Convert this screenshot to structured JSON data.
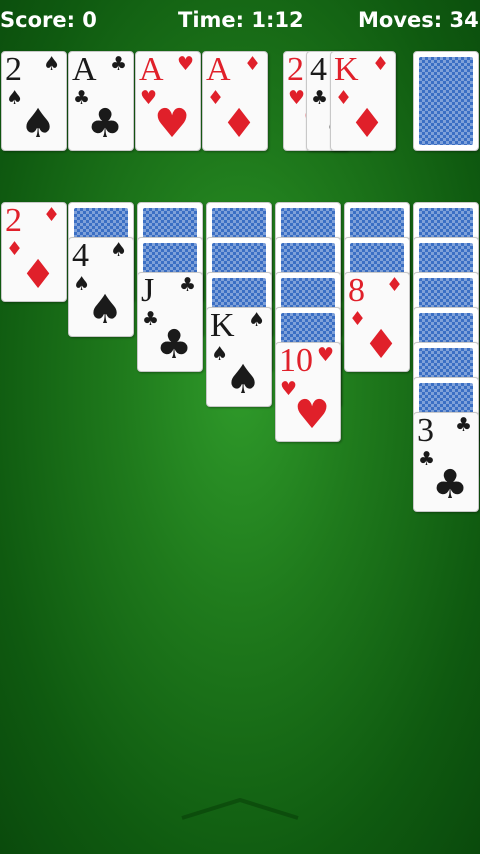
{
  "hud": {
    "score_label": "Score: 0",
    "time_label": "Time: 1:12",
    "moves_label": "Moves: 34"
  },
  "colors": {
    "felt": "#1f7a1c",
    "red_suit": "#e0202a",
    "black_suit": "#1a1a1a",
    "card_back": "#3b6fc4"
  },
  "foundations": [
    {
      "rank": "2",
      "suit": "♠",
      "color": "black"
    },
    {
      "rank": "A",
      "suit": "♣",
      "color": "black"
    },
    {
      "rank": "A",
      "suit": "♥",
      "color": "red"
    },
    {
      "rank": "A",
      "suit": "♦",
      "color": "red"
    }
  ],
  "waste": [
    {
      "rank": "2",
      "suit": "♥",
      "color": "red"
    },
    {
      "rank": "4",
      "suit": "♣",
      "color": "black"
    },
    {
      "rank": "K",
      "suit": "♦",
      "color": "red"
    }
  ],
  "tableau": [
    {
      "hidden": 0,
      "up": [
        {
          "rank": "2",
          "suit": "♦",
          "color": "red"
        }
      ]
    },
    {
      "hidden": 1,
      "up": [
        {
          "rank": "4",
          "suit": "♠",
          "color": "black"
        }
      ]
    },
    {
      "hidden": 2,
      "up": [
        {
          "rank": "J",
          "suit": "♣",
          "color": "black"
        }
      ]
    },
    {
      "hidden": 3,
      "up": [
        {
          "rank": "K",
          "suit": "♠",
          "color": "black"
        }
      ]
    },
    {
      "hidden": 4,
      "up": [
        {
          "rank": "10",
          "suit": "♥",
          "color": "red"
        }
      ]
    },
    {
      "hidden": 2,
      "up": [
        {
          "rank": "8",
          "suit": "♦",
          "color": "red"
        }
      ]
    },
    {
      "hidden": 6,
      "up": [
        {
          "rank": "3",
          "suit": "♣",
          "color": "black"
        }
      ]
    }
  ]
}
